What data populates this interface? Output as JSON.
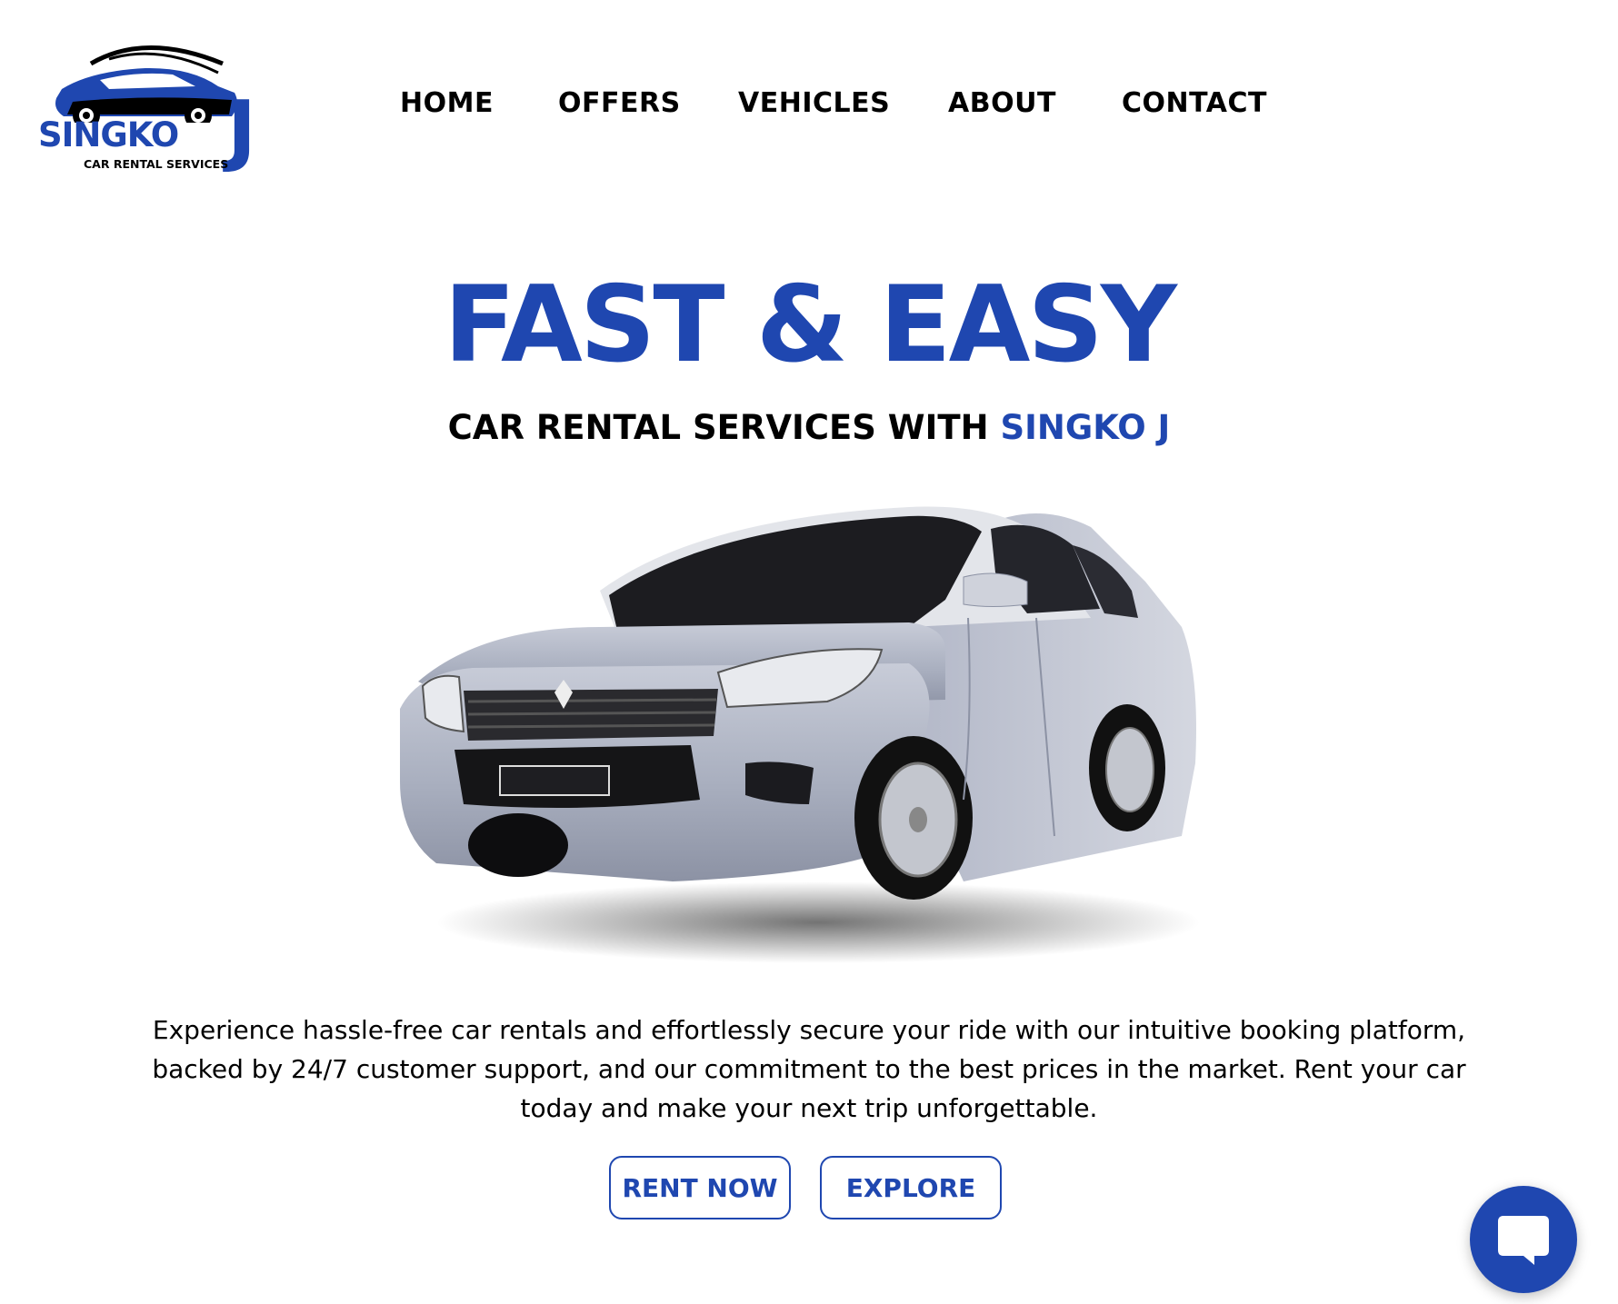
{
  "brand": {
    "name": "SINGKO",
    "letter": "J",
    "tagline": "CAR RENTAL SERVICES"
  },
  "nav": {
    "items": [
      {
        "label": "HOME"
      },
      {
        "label": "OFFERS"
      },
      {
        "label": "VEHICLES"
      },
      {
        "label": "ABOUT"
      },
      {
        "label": "CONTACT"
      }
    ]
  },
  "hero": {
    "title": "FAST & EASY",
    "subtitle_prefix": "CAR RENTAL SERVICES WITH ",
    "subtitle_accent": "SINGKO J",
    "description": "Experience hassle-free car rentals and effortlessly secure your ride with our intuitive booking platform, backed by 24/7 customer support, and our commitment to the best prices in the market. Rent your car today and make your next trip unforgettable.",
    "car_image": "silver-sedan-image"
  },
  "actions": {
    "rent_label": "RENT NOW",
    "explore_label": "EXPLORE"
  },
  "chat": {
    "icon": "chat-bubble-icon"
  },
  "colors": {
    "accent": "#1f47b0",
    "text": "#000000",
    "background": "#ffffff"
  }
}
